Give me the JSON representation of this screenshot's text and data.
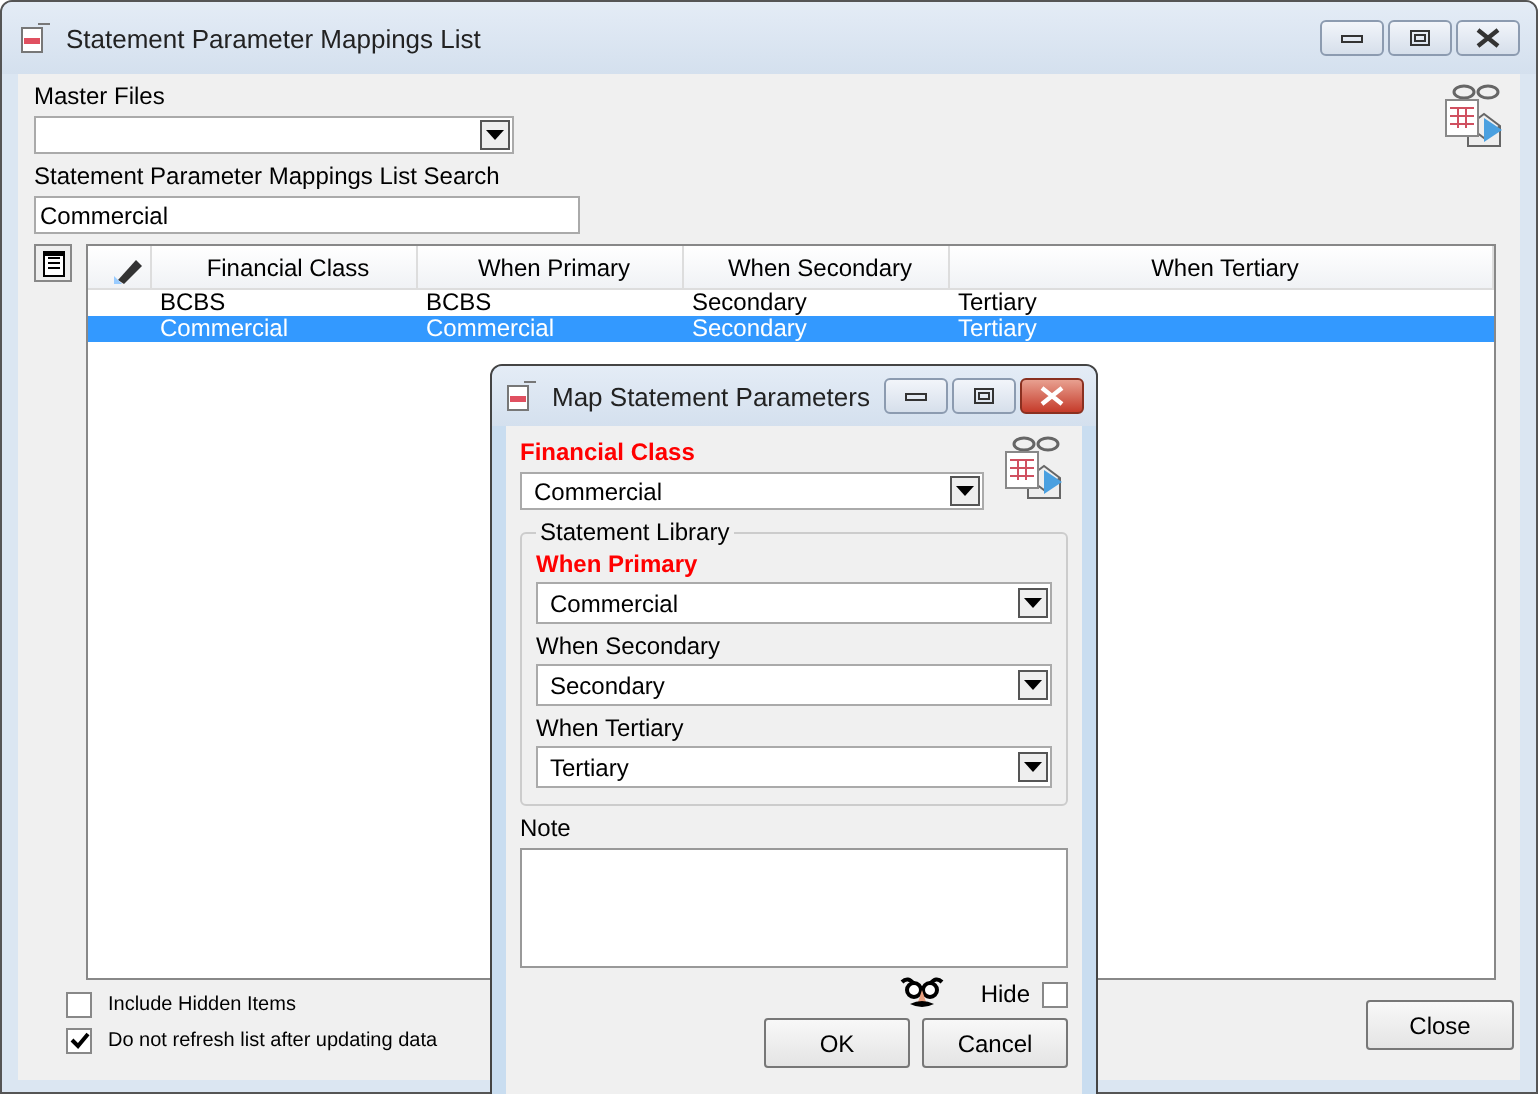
{
  "window": {
    "title": "Statement Parameter Mappings List"
  },
  "master_files": {
    "label": "Master Files"
  },
  "search": {
    "label": "Statement Parameter Mappings List Search",
    "value": "Commercial"
  },
  "table": {
    "columns": [
      "Financial Class",
      "When Primary",
      "When Secondary",
      "When Tertiary"
    ],
    "rows": [
      {
        "cells": [
          "BCBS",
          "BCBS",
          "Secondary",
          "Tertiary"
        ],
        "selected": false
      },
      {
        "cells": [
          "Commercial",
          "Commercial",
          "Secondary",
          "Tertiary"
        ],
        "selected": true
      }
    ]
  },
  "options": [
    {
      "label": "Include Hidden Items",
      "checked": false
    },
    {
      "label": "Do not refresh list after updating data",
      "checked": true
    }
  ],
  "close_button": "Close",
  "dialog": {
    "title": "Map Statement Parameters",
    "financial_class": {
      "label": "Financial Class",
      "required": true,
      "value": "Commercial"
    },
    "group_title": "Statement Library",
    "fields": [
      {
        "label": "When Primary",
        "required": true,
        "value": "Commercial"
      },
      {
        "label": "When Secondary",
        "required": false,
        "value": "Secondary"
      },
      {
        "label": "When Tertiary",
        "required": false,
        "value": "Tertiary"
      }
    ],
    "note_label": "Note",
    "hide": {
      "label": "Hide",
      "checked": false
    },
    "buttons": [
      "OK",
      "Cancel"
    ]
  }
}
